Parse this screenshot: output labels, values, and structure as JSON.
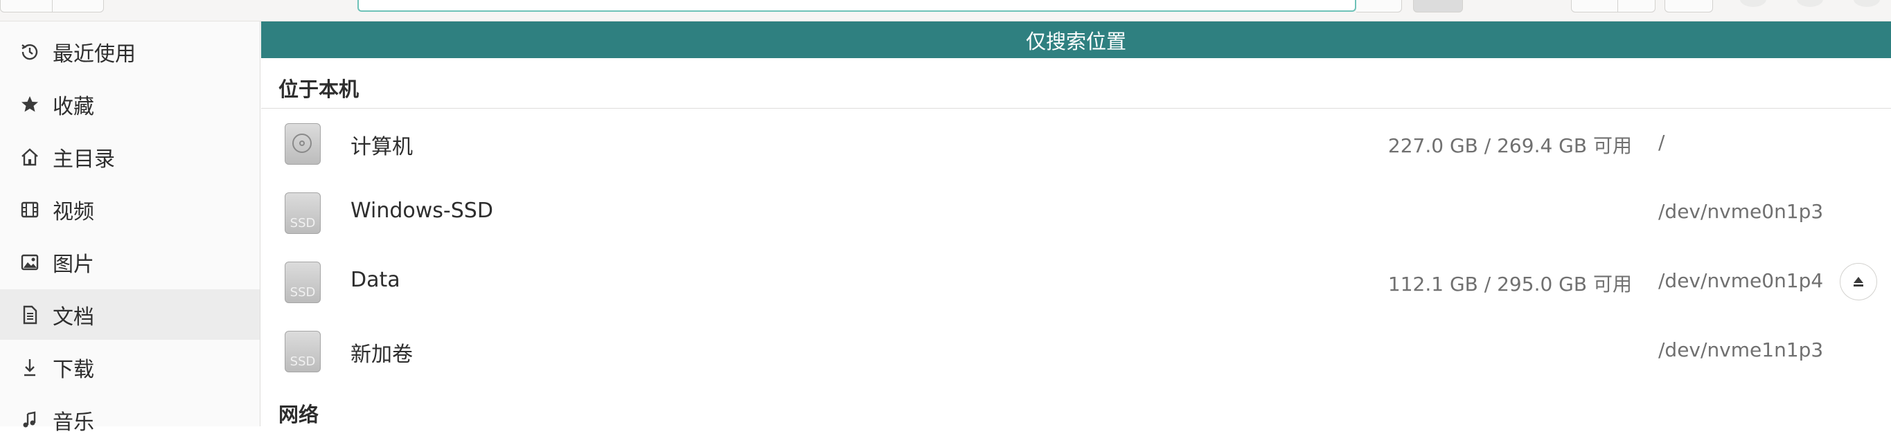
{
  "search_banner": "仅搜索位置",
  "sidebar": {
    "items": [
      {
        "label": "最近使用",
        "icon": "clock-icon"
      },
      {
        "label": "收藏",
        "icon": "star-icon"
      },
      {
        "label": "主目录",
        "icon": "home-icon"
      },
      {
        "label": "视频",
        "icon": "film-icon"
      },
      {
        "label": "图片",
        "icon": "image-icon"
      },
      {
        "label": "文档",
        "icon": "document-icon",
        "active": true
      },
      {
        "label": "下载",
        "icon": "download-icon"
      },
      {
        "label": "音乐",
        "icon": "music-icon"
      }
    ]
  },
  "main": {
    "local_header": "位于本机",
    "network_header": "网络",
    "drives": [
      {
        "name": "计算机",
        "space": "227.0 GB / 269.4 GB 可用",
        "path": "/",
        "icon": "hard-disk-icon"
      },
      {
        "name": "Windows-SSD",
        "space": "",
        "path": "/dev/nvme0n1p3",
        "icon": "ssd-drive-icon",
        "icon_text": "SSD"
      },
      {
        "name": "Data",
        "space": "112.1 GB / 295.0 GB 可用",
        "path": "/dev/nvme0n1p4",
        "icon": "ssd-drive-icon",
        "icon_text": "SSD",
        "eject": true
      },
      {
        "name": "新加卷",
        "space": "",
        "path": "/dev/nvme1n1p3",
        "icon": "ssd-drive-icon",
        "icon_text": "SSD"
      }
    ]
  },
  "colors": {
    "banner": "#2f8080",
    "entry_focus": "#6ec2b8"
  }
}
